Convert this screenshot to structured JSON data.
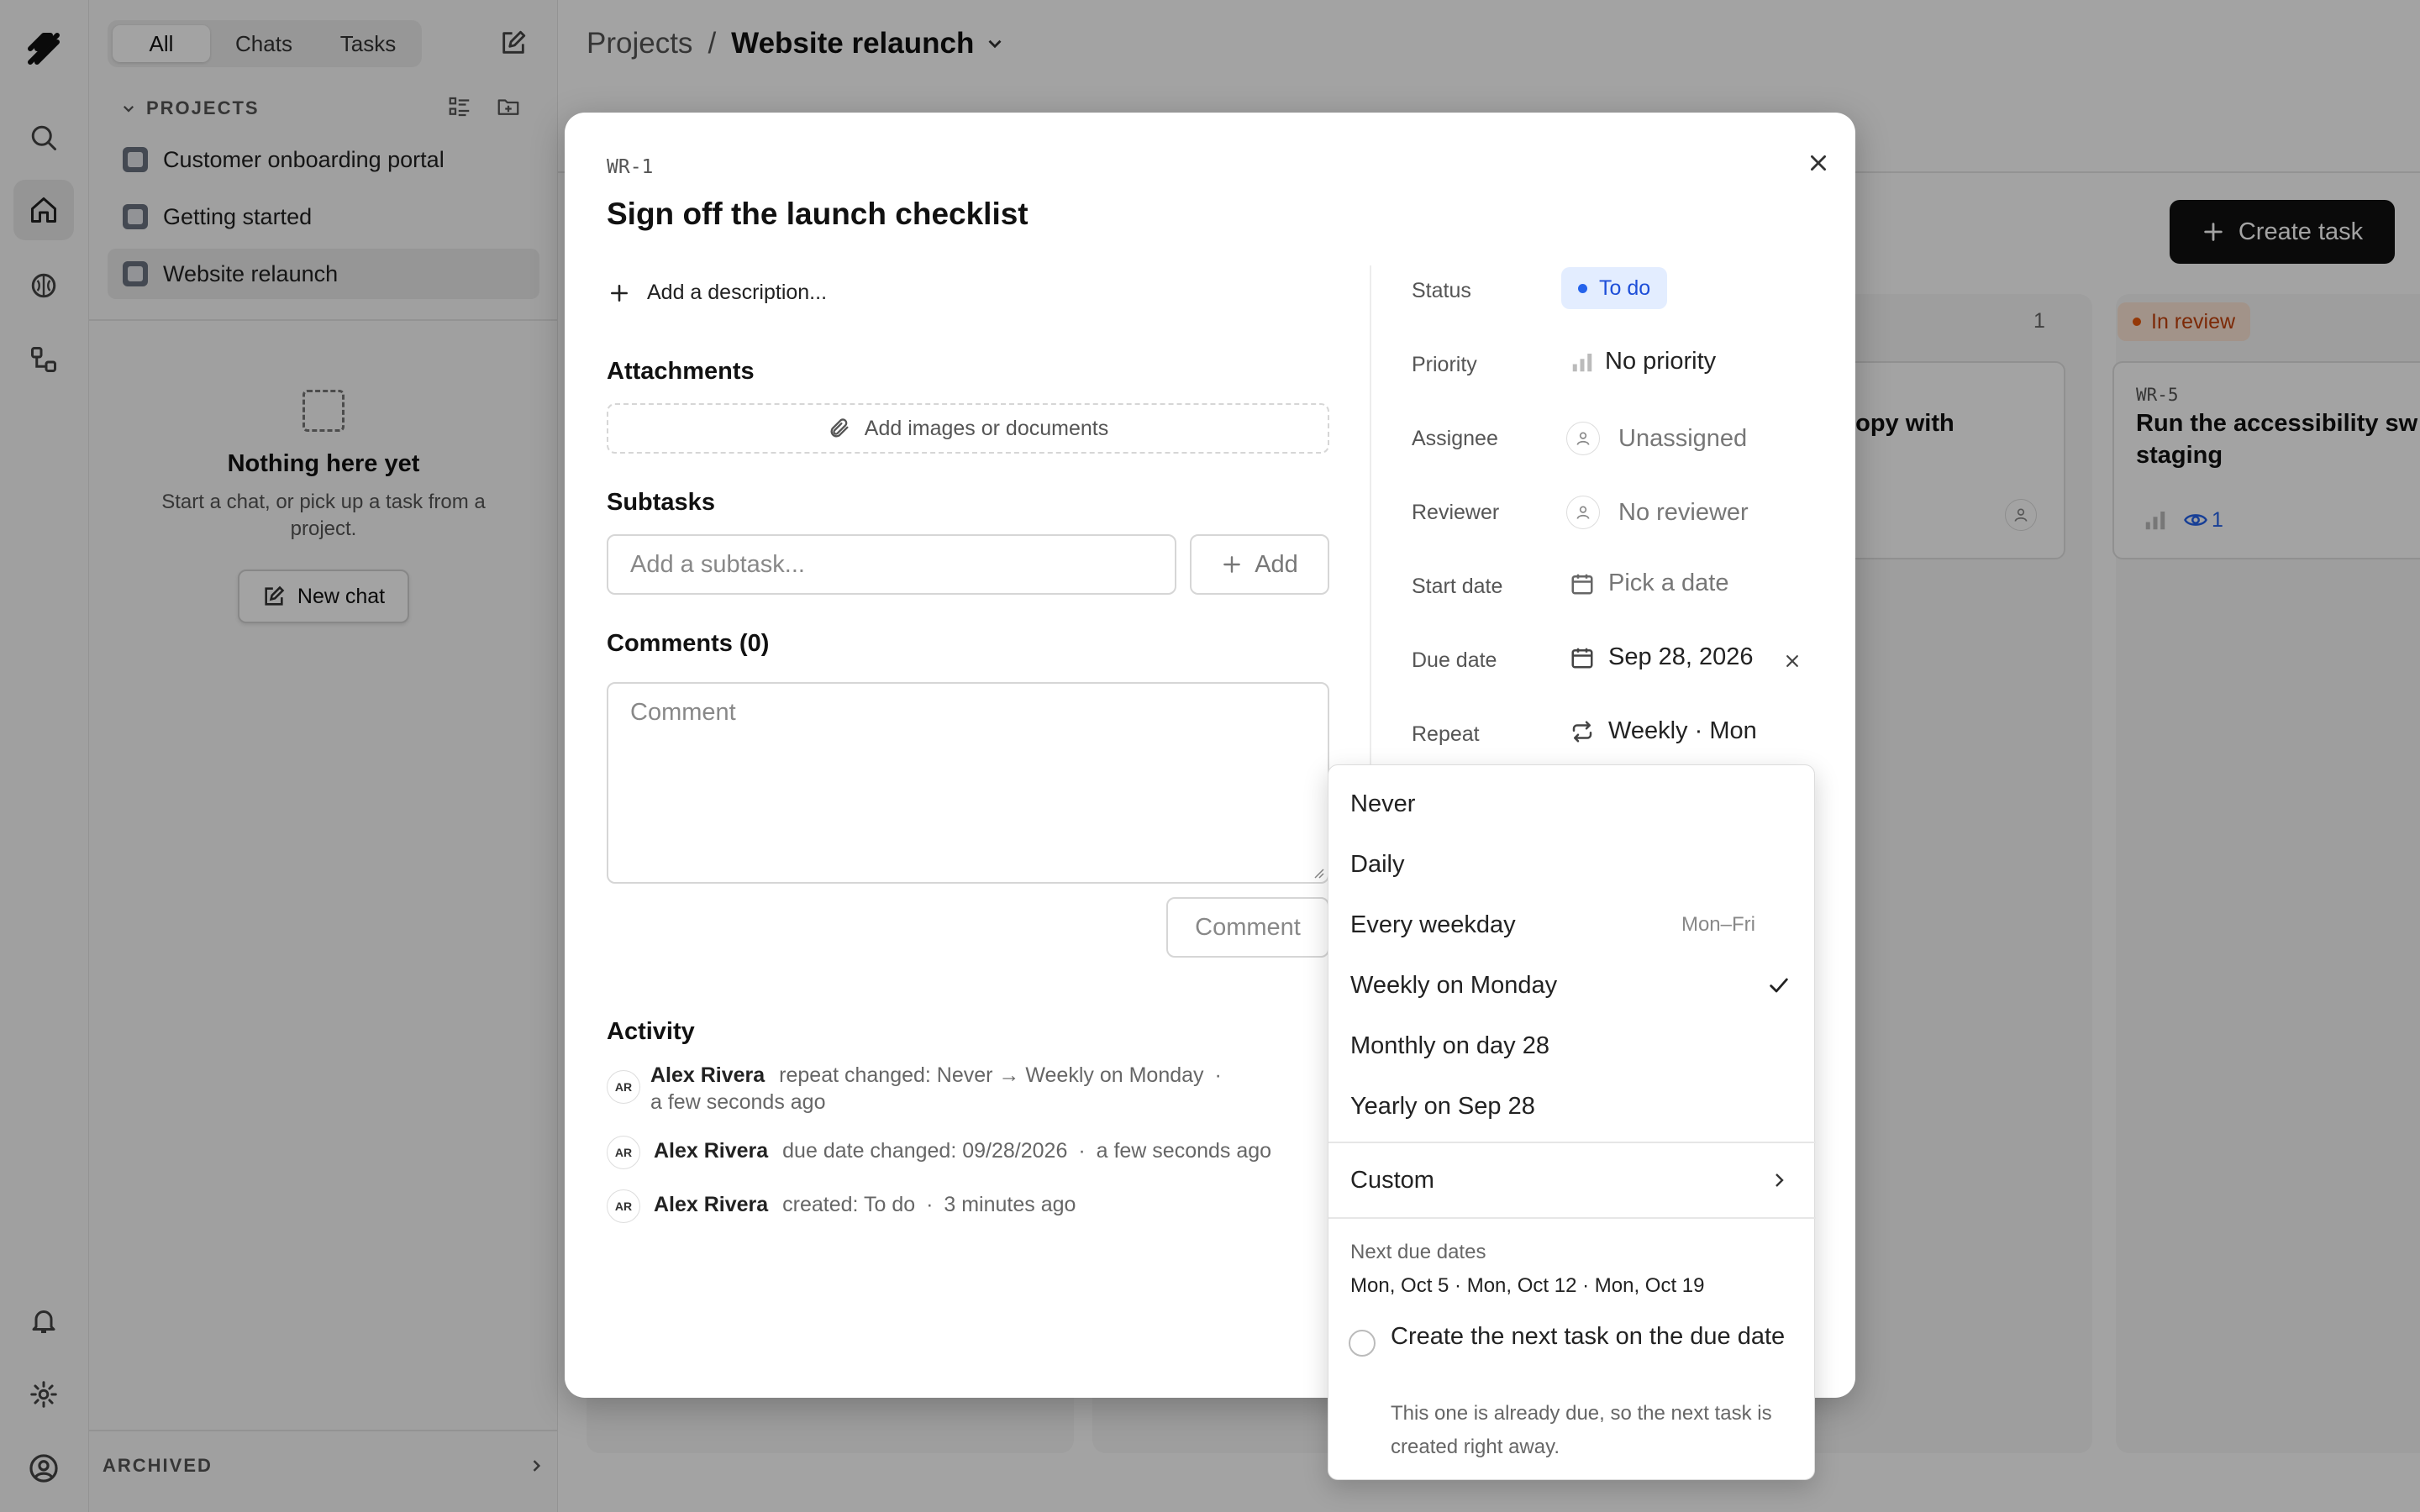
{
  "sidebar": {
    "tabs": [
      "All",
      "Chats",
      "Tasks"
    ],
    "projects_header": "PROJECTS",
    "projects": [
      "Customer onboarding portal",
      "Getting started",
      "Website relaunch"
    ],
    "empty_title": "Nothing here yet",
    "empty_sub": "Start a chat, or pick up a task from a project.",
    "new_chat": "New chat",
    "archived": "ARCHIVED"
  },
  "header": {
    "crumb_root": "Projects",
    "separator": "/",
    "current_project": "Website relaunch"
  },
  "board": {
    "create_task": "Create task",
    "column_count": "1",
    "column_label": "In review",
    "card_fragment": "copy with",
    "card_id": "WR-5",
    "card_title_line1": "Run the accessibility sw",
    "card_title_line2": "staging",
    "card_views": "1"
  },
  "modal": {
    "task_id": "WR-1",
    "title": "Sign off the launch checklist",
    "add_description": "Add a description...",
    "attachments_title": "Attachments",
    "attachments_cta": "Add images or documents",
    "subtasks_title": "Subtasks",
    "subtask_placeholder": "Add a subtask...",
    "subtask_add": "Add",
    "comments_title": "Comments (0)",
    "comment_placeholder": "Comment",
    "comment_button": "Comment",
    "activity_title": "Activity",
    "activity": [
      {
        "initials": "AR",
        "name": "Alex Rivera",
        "text": "repeat changed: Never → Weekly on Monday",
        "time": "a few seconds ago"
      },
      {
        "initials": "AR",
        "name": "Alex Rivera",
        "text": "due date changed: 09/28/2026",
        "time": "a few seconds ago"
      },
      {
        "initials": "AR",
        "name": "Alex Rivera",
        "text": "created: To do",
        "time": "3 minutes ago"
      }
    ],
    "fields": {
      "status_label": "Status",
      "status_value": "To do",
      "priority_label": "Priority",
      "priority_value": "No priority",
      "assignee_label": "Assignee",
      "assignee_value": "Unassigned",
      "reviewer_label": "Reviewer",
      "reviewer_value": "No reviewer",
      "start_label": "Start date",
      "start_value": "Pick a date",
      "due_label": "Due date",
      "due_value": "Sep 28, 2026",
      "repeat_label": "Repeat",
      "repeat_value": "Weekly · Mon"
    }
  },
  "repeat_menu": {
    "options": [
      "Never",
      "Daily",
      "Every weekday",
      "Weekly on Monday",
      "Monthly on day 28",
      "Yearly on Sep 28"
    ],
    "weekday_hint": "Mon–Fri",
    "selected": "Weekly on Monday",
    "custom": "Custom",
    "next_title": "Next due dates",
    "next_dates": "Mon, Oct 5 · Mon, Oct 12 · Mon, Oct 19",
    "create_next_label": "Create the next task on the due date",
    "create_next_checked": false,
    "create_next_help": "This one is already due, so the next task is created right away."
  },
  "colors": {
    "status_blue": "#2563eb",
    "review_orange": "#ea580c",
    "primary_dark": "#111111"
  }
}
